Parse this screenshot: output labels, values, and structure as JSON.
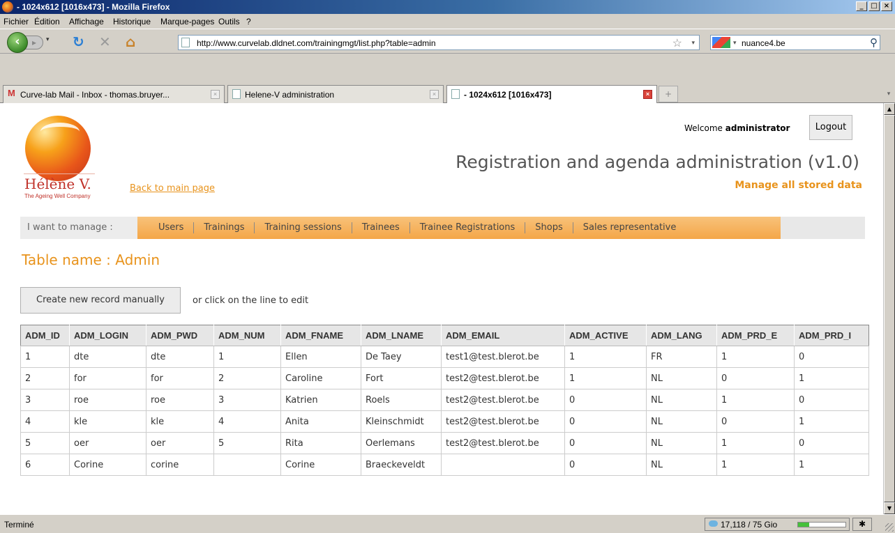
{
  "window": {
    "title": "- 1024x612 [1016x473] - Mozilla Firefox"
  },
  "menu": [
    "Fichier",
    "Édition",
    "Affichage",
    "Historique",
    "Marque-pages",
    "Outils",
    "?"
  ],
  "nav": {
    "url": "http://www.curvelab.dldnet.com/trainingmgt/list.php?table=admin",
    "search_value": "nuance4.be"
  },
  "tabs": [
    {
      "label": "Curve-lab Mail - Inbox - thomas.bruyer..."
    },
    {
      "label": "Helene-V administration"
    },
    {
      "label": "- 1024x612 [1016x473]"
    }
  ],
  "page": {
    "logo_name": "Hélène V.",
    "logo_tagline": "The Ageing Well Company",
    "back_link": "Back to main page",
    "welcome_prefix": "Welcome",
    "welcome_user": "administrator",
    "logout": "Logout",
    "title": "Registration and agenda administration (v1.0)",
    "subtitle": "Manage all stored data",
    "manage_label": "I want to manage :",
    "manage_items": [
      "Users",
      "Trainings",
      "Training sessions",
      "Trainees",
      "Trainee Registrations",
      "Shops",
      "Sales representative"
    ],
    "table_name": "Table name : Admin",
    "create_button": "Create new record manually",
    "hint": "or click on the line to edit"
  },
  "table": {
    "columns": [
      "ADM_ID",
      "ADM_LOGIN",
      "ADM_PWD",
      "ADM_NUM",
      "ADM_FNAME",
      "ADM_LNAME",
      "ADM_EMAIL",
      "ADM_ACTIVE",
      "ADM_LANG",
      "ADM_PRD_E",
      "ADM_PRD_I"
    ],
    "rows": [
      [
        "1",
        "dte",
        "dte",
        "1",
        "Ellen",
        "De Taey",
        "test1@test.blerot.be",
        "1",
        "FR",
        "1",
        "0"
      ],
      [
        "2",
        "for",
        "for",
        "2",
        "Caroline",
        "Fort",
        "test2@test.blerot.be",
        "1",
        "NL",
        "0",
        "1"
      ],
      [
        "3",
        "roe",
        "roe",
        "3",
        "Katrien",
        "Roels",
        "test2@test.blerot.be",
        "0",
        "NL",
        "1",
        "0"
      ],
      [
        "4",
        "kle",
        "kle",
        "4",
        "Anita",
        "Kleinschmidt",
        "test2@test.blerot.be",
        "0",
        "NL",
        "0",
        "1"
      ],
      [
        "5",
        "oer",
        "oer",
        "5",
        "Rita",
        "Oerlemans",
        "test2@test.blerot.be",
        "0",
        "NL",
        "1",
        "0"
      ],
      [
        "6",
        "Corine",
        "corine",
        "",
        "Corine",
        "Braeckeveldt",
        "",
        "0",
        "NL",
        "1",
        "1"
      ]
    ]
  },
  "status": {
    "text": "Terminé",
    "memory": "17,118 / 75 Gio",
    "memory_fraction": 0.228
  },
  "colors": {
    "accent": "#e8931c",
    "title_bar": "#0a246a"
  }
}
